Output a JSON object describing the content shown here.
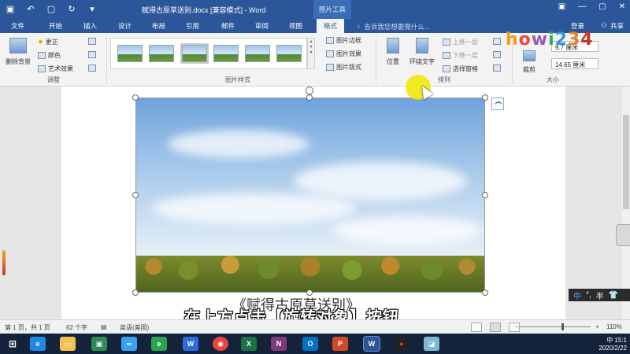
{
  "titlebar": {
    "doc_title": "赋得古原草送别.docx [兼容模式] - Word",
    "context_tab": "图片工具",
    "qat": [
      "save-icon",
      "undo-icon",
      "new-doc-icon",
      "redo-icon",
      "customize-icon"
    ]
  },
  "tabs": [
    "文件",
    "开始",
    "插入",
    "设计",
    "布局",
    "引用",
    "邮件",
    "审阅",
    "视图",
    "格式"
  ],
  "active_tab": "格式",
  "search_hint": "告诉我您想要做什么...",
  "login": "登录",
  "share": "共享",
  "ribbon": {
    "adjust": {
      "remove_bg": "删除背景",
      "corrections": "更正",
      "color": "颜色",
      "artistic": "艺术效果",
      "label": "调整"
    },
    "styles": {
      "label": "图片样式",
      "border": "图片边框",
      "effects": "图片效果",
      "layout": "图片版式"
    },
    "arrange": {
      "label": "排列",
      "position": "位置",
      "wrap_text": "环绕文字",
      "bring_forward": "上移一层",
      "send_backward": "下移一层",
      "selection_pane": "选择窗格"
    },
    "size": {
      "label": "大小",
      "crop": "裁剪",
      "height": "9.7 厘米",
      "width": "14.65 厘米"
    }
  },
  "logo": [
    "h",
    "o",
    "w",
    "i",
    "2",
    "3",
    "4"
  ],
  "document": {
    "caption": "《赋得古原草送别》"
  },
  "subtitle": "在上方点击【旋转对象】按钮",
  "ime": {
    "lang": "中",
    "punct": "°,",
    "width": "半"
  },
  "status": {
    "page": "第 1 页，共 1 页",
    "words": "62 个字",
    "lang": "英语(美国)",
    "zoom": "110%"
  },
  "taskbar": {
    "apps": [
      "ie-icon",
      "explorer-icon",
      "store-icon",
      "baidu-netdisk-icon",
      "edge-ie-icon",
      "wps-icon",
      "chrome-icon",
      "excel-icon",
      "onenote-icon",
      "outlook-icon",
      "powerpoint-icon",
      "word-icon",
      "record-icon",
      "notes-icon"
    ],
    "time": "15:1",
    "date": "2020/2/22",
    "tray_lang": "中"
  }
}
